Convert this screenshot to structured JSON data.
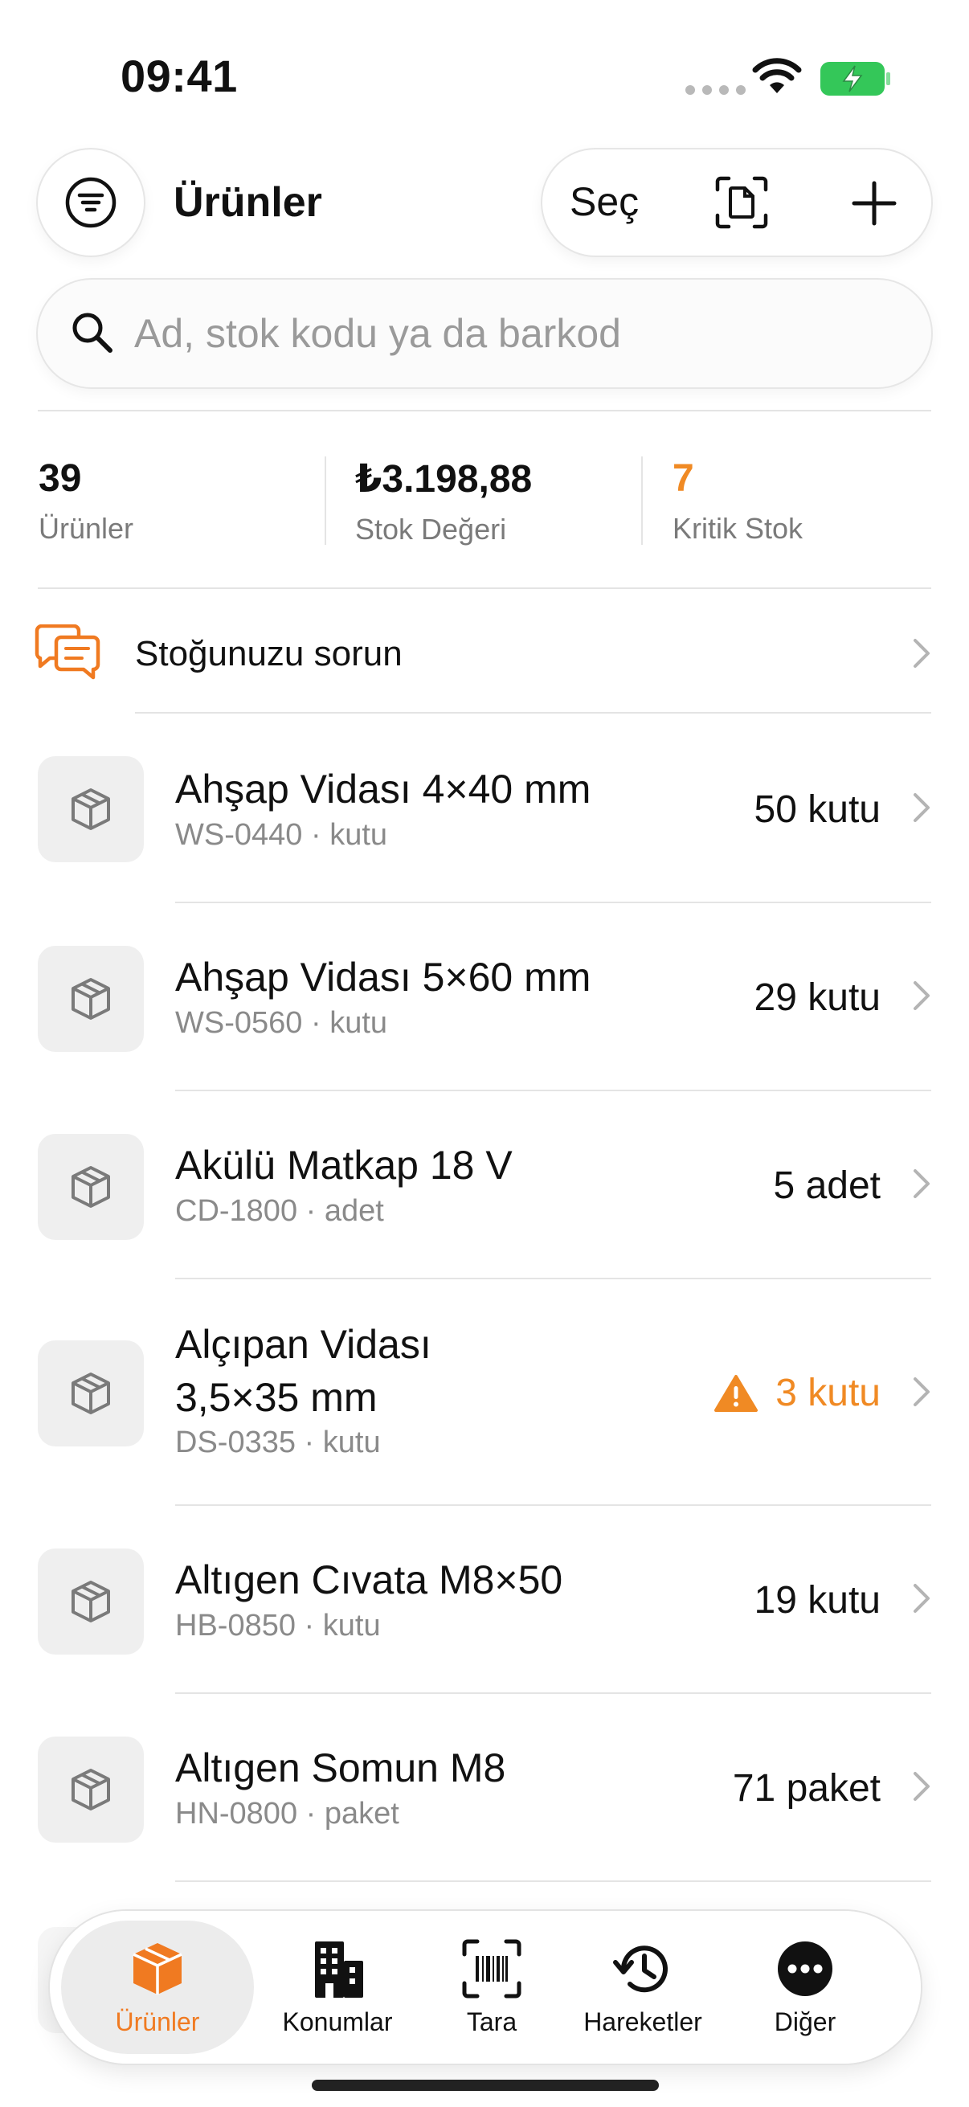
{
  "status_bar": {
    "time": "09:41"
  },
  "header": {
    "title": "Ürünler",
    "select_label": "Seç",
    "icons": {
      "filter": "filter-icon",
      "scan_document": "document-scan-icon",
      "add": "plus-icon"
    }
  },
  "search": {
    "placeholder": "Ad, stok kodu ya da barkod",
    "value": ""
  },
  "stats": [
    {
      "value": "39",
      "label": "Ürünler"
    },
    {
      "value": "₺3.198,88",
      "label": "Stok Değeri"
    },
    {
      "value": "7",
      "label": "Kritik Stok"
    }
  ],
  "colors": {
    "accent": "#F07A21",
    "warning": "#F08A24",
    "battery": "#34C759"
  },
  "ask": {
    "label": "Stoğunuzu sorun",
    "icon": "chat-bubbles-icon"
  },
  "products": [
    {
      "name": "Ahşap Vidası 4×40 mm",
      "code": "WS-0440",
      "unit": "kutu",
      "quantity": "50 kutu",
      "critical": false
    },
    {
      "name": "Ahşap Vidası 5×60 mm",
      "code": "WS-0560",
      "unit": "kutu",
      "quantity": "29 kutu",
      "critical": false
    },
    {
      "name": "Akülü Matkap 18 V",
      "code": "CD-1800",
      "unit": "adet",
      "quantity": "5 adet",
      "critical": false
    },
    {
      "name_line1": "Alçıpan Vidası",
      "name_line2": "3,5×35 mm",
      "code": "DS-0335",
      "unit": "kutu",
      "quantity": "3 kutu",
      "critical": true
    },
    {
      "name": "Altıgen Cıvata M8×50",
      "code": "HB-0850",
      "unit": "kutu",
      "quantity": "19 kutu",
      "critical": false
    },
    {
      "name": "Altıgen Somun M8",
      "code": "HN-0800",
      "unit": "paket",
      "quantity": "71 paket",
      "critical": false
    }
  ],
  "tabbar": [
    {
      "label": "Ürünler",
      "icon": "box-icon",
      "active": true
    },
    {
      "label": "Konumlar",
      "icon": "building-icon",
      "active": false
    },
    {
      "label": "Tara",
      "icon": "barcode-scan-icon",
      "active": false
    },
    {
      "label": "Hareketler",
      "icon": "history-icon",
      "active": false
    },
    {
      "label": "Diğer",
      "icon": "more-icon",
      "active": false
    }
  ]
}
